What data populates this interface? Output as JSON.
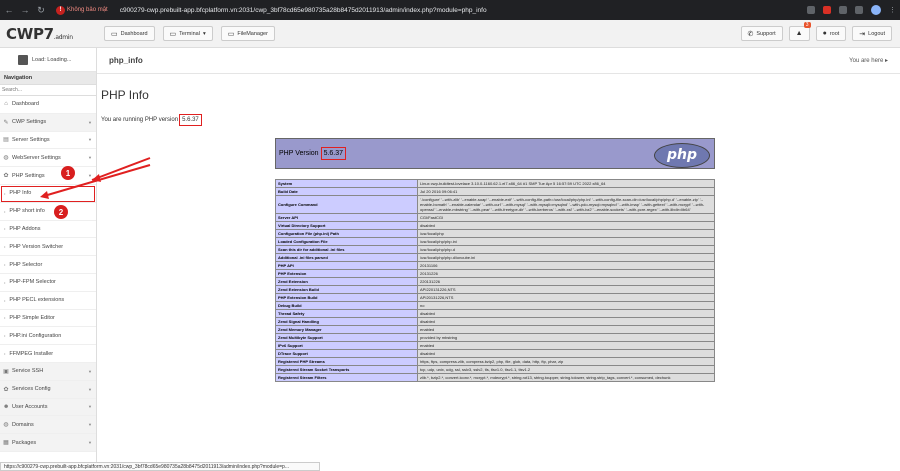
{
  "browser": {
    "insecure_label": "Không bảo mật",
    "url": "c900279-cwp.prebuilt-app.bfcplatform.vn:2031/cwp_3bf78cd65e980735a28b8475d2011913/admin/index.php?module=php_info"
  },
  "header": {
    "logo": "CWP7",
    "logo_sub": ".admin",
    "buttons": [
      "Dashboard",
      "Terminal",
      "FileManager"
    ],
    "support": "Support",
    "notif_count": "3",
    "user": "root",
    "logout": "Logout"
  },
  "sidebar": {
    "user_status": "Load: Loading...",
    "nav_title": "Navigation",
    "search_placeholder": "Search...",
    "items": [
      {
        "label": "Dashboard",
        "type": "item",
        "icon": "home-icon"
      },
      {
        "label": "CWP Settings",
        "type": "group",
        "icon": "wrench-icon"
      },
      {
        "label": "Server Settings",
        "type": "item",
        "icon": "server-icon"
      },
      {
        "label": "WebServer Settings",
        "type": "item",
        "icon": "globe-icon"
      },
      {
        "label": "PHP Settings",
        "type": "item",
        "icon": "gear-icon"
      },
      {
        "label": "PHP Info",
        "type": "active",
        "icon": "bullet-icon"
      },
      {
        "label": "PHP short info",
        "type": "sub",
        "icon": "bullet-icon"
      },
      {
        "label": "PHP Addons",
        "type": "sub",
        "icon": "bullet-icon"
      },
      {
        "label": "PHP Version Switcher",
        "type": "sub",
        "icon": "bullet-icon"
      },
      {
        "label": "PHP Selector",
        "type": "sub",
        "icon": "bullet-icon"
      },
      {
        "label": "PHP-FPM Selector",
        "type": "sub",
        "icon": "bullet-icon"
      },
      {
        "label": "PHP PECL extensions",
        "type": "sub",
        "icon": "bullet-icon"
      },
      {
        "label": "PHP Simple Editor",
        "type": "sub",
        "icon": "bullet-icon"
      },
      {
        "label": "PHP.ini Configuration",
        "type": "sub",
        "icon": "bullet-icon"
      },
      {
        "label": "FFMPEG Installer",
        "type": "sub",
        "icon": "bullet-icon"
      },
      {
        "label": "Service SSH",
        "type": "group",
        "icon": "terminal-icon"
      },
      {
        "label": "Services Config",
        "type": "group",
        "icon": "cog-icon"
      },
      {
        "label": "User Accounts",
        "type": "group",
        "icon": "users-icon"
      },
      {
        "label": "Domains",
        "type": "group",
        "icon": "globe-icon"
      },
      {
        "label": "Packages",
        "type": "group",
        "icon": "box-icon"
      }
    ]
  },
  "main": {
    "breadcrumb_title": "php_info",
    "here_label": "You are here",
    "page_title": "PHP Info",
    "running_text": "You are running PHP version",
    "running_version": "5.6.37"
  },
  "phpinfo": {
    "version_label": "PHP Version",
    "version": "5.6.37",
    "logo_text": "php",
    "rows": [
      [
        "System",
        "Linux cwp-buildtest-lovelace 3.10.0-1160.62.1.el7.x86_64 #1 SMP Tue Apr 5 16:57:59 UTC 2022 x86_64"
      ],
      [
        "Build Date",
        "Jul 20 2016 09:06:41"
      ],
      [
        "Configure Command",
        "'./configure' '--with-zlib' '--enable-soap' '--enable-exif' '--with-config-file-path=/usr/local/php/php.ini' '--with-config-file-scan-dir=/usr/local/php/php.d' '--enable-zip' '--enable-bcmath' '--enable-calendar' '--with-curl' '--with-mysql' '--with-mysqli=mysqlnd' '--with-pdo-mysql=mysqlnd' '--with-imap' '--with-gettext' '--with-mcrypt' '--with-openssl' '--enable-mbstring' '--with-pear' '--with-freetype-dir' '--with-kerberos' '--with-xsl' '--with-bz2' '--enable-sockets' '--with-pcre-regex' '--with-libdir=lib64'"
      ],
      [
        "Server API",
        "CGI/FastCGI"
      ],
      [
        "Virtual Directory Support",
        "disabled"
      ],
      [
        "Configuration File (php.ini) Path",
        "/usr/local/php"
      ],
      [
        "Loaded Configuration File",
        "/usr/local/php/php.ini"
      ],
      [
        "Scan this dir for additional .ini files",
        "/usr/local/php/php.d"
      ],
      [
        "Additional .ini files parsed",
        "/usr/local/php/php.d/ioncube.ini"
      ],
      [
        "PHP API",
        "20131106"
      ],
      [
        "PHP Extension",
        "20131226"
      ],
      [
        "Zend Extension",
        "220131226"
      ],
      [
        "Zend Extension Build",
        "API220131226,NTS"
      ],
      [
        "PHP Extension Build",
        "API20131226,NTS"
      ],
      [
        "Debug Build",
        "no"
      ],
      [
        "Thread Safety",
        "disabled"
      ],
      [
        "Zend Signal Handling",
        "disabled"
      ],
      [
        "Zend Memory Manager",
        "enabled"
      ],
      [
        "Zend Multibyte Support",
        "provided by mbstring"
      ],
      [
        "IPv6 Support",
        "enabled"
      ],
      [
        "DTrace Support",
        "disabled"
      ],
      [
        "Registered PHP Streams",
        "https, ftps, compress.zlib, compress.bzip2, php, file, glob, data, http, ftp, phar, zip"
      ],
      [
        "Registered Stream Socket Transports",
        "tcp, udp, unix, udg, ssl, sslv3, sslv2, tls, tlsv1.0, tlsv1.1, tlsv1.2"
      ],
      [
        "Registered Stream Filters",
        "zlib.*, bzip2.*, convert.iconv.*, mcrypt.*, mdecrypt.*, string.rot13, string.toupper, string.tolower, string.strip_tags, convert.*, consumed, dechunk"
      ]
    ]
  },
  "annotations": {
    "marker1": "1",
    "marker2": "2"
  },
  "status_url": "https://c900279-cwp.prebuilt-app.bfcplatform.vn:2031/cwp_3bf78cd65e980735a28b8475d2011913/admin/index.php?module=p..."
}
